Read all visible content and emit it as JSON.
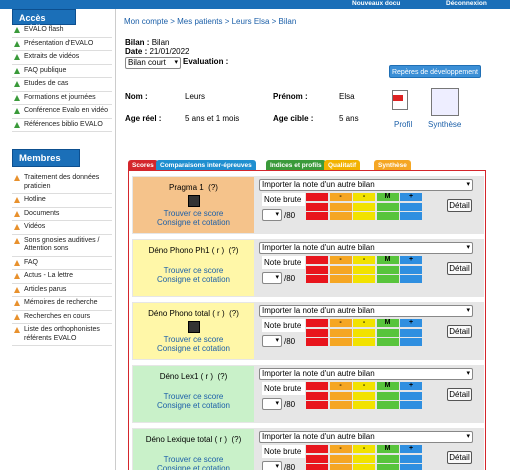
{
  "topbar": {
    "news": "Nouveaux docu",
    "logout": "Déconnexion"
  },
  "sidebar": {
    "public_title": "Accès public",
    "public_items": [
      "EVALO flash",
      "Présentation d'EVALO",
      "Extraits de vidéos",
      "FAQ publique",
      "Etudes de cas",
      "Formations et journées",
      "Conférence Evalo en vidéo",
      "Références biblio EVALO"
    ],
    "members_title": "Membres",
    "members_items": [
      "Traitement des données praticien",
      "Hotline",
      "Documents",
      "Vidéos",
      "Sons gnosies auditives / Attention sons",
      "FAQ",
      "Actus - La lettre",
      "Articles parus",
      "Mémoires de recherche",
      "Recherches en cours",
      "Liste des orthophonistes référents EVALO"
    ]
  },
  "breadcrumb": "Mon compte > Mes patients > Leurs Elsa > Bilan",
  "bilan": {
    "bilan_label": "Bilan :",
    "bilan_value": "Bilan",
    "date_label": "Date :",
    "date_value": "21/01/2022",
    "select_value": "Bilan court",
    "evaluation_label": "Evaluation :",
    "repere_button": "Repères de développement"
  },
  "patient": {
    "nom_label": "Nom :",
    "nom_value": "Leurs",
    "prenom_label": "Prénom :",
    "prenom_value": "Elsa",
    "age_reel_label": "Age réel :",
    "age_reel_value": "5 ans et 1 mois",
    "age_cible_label": "Age cible :",
    "age_cible_value": "5 ans",
    "profil_label": "Profil",
    "synthese_label": "Synthèse"
  },
  "tabs": [
    {
      "label": "Scores",
      "color": "#d4262c"
    },
    {
      "label": "Comparaisons inter-épreuves",
      "color": "#1f8fd0"
    },
    {
      "label": "Indices et profils",
      "color": "#3a9a3a"
    },
    {
      "label": "Qualitatif",
      "color": "#f2b200"
    },
    {
      "label": "Synthèse",
      "color": "#f5a623"
    }
  ],
  "tests": [
    {
      "name": "Pragma 1",
      "help": "(?)",
      "link1": "Trouver ce score",
      "link2": "Consigne et cotation",
      "bg": "#f5c38b",
      "video": true
    },
    {
      "name": "Déno Phono Ph1 ( r )",
      "help": "(?)",
      "link1": "Trouver ce score",
      "link2": "Consigne et cotation",
      "bg": "#fff7a8",
      "video": false
    },
    {
      "name": "Déno Phono total ( r )",
      "help": "(?)",
      "link1": "Trouver ce score",
      "link2": "Consigne et cotation",
      "bg": "#fff7a8",
      "video": true
    },
    {
      "name": "Déno Lex1 ( r )",
      "help": "(?)",
      "link1": "Trouver ce score",
      "link2": "Consigne et cotation",
      "bg": "#c9f1c9",
      "video": false
    },
    {
      "name": "Déno Lexique total ( r )",
      "help": "(?)",
      "link1": "Trouver ce score",
      "link2": "Consigne et cotation",
      "bg": "#c9f1c9",
      "video": false
    }
  ],
  "row_controls": {
    "import_select": "Importer la note d'un autre bilan",
    "note_brute": "Note brute",
    "slash80": "/80",
    "detail": "Détail",
    "grid_labels": [
      "-",
      "-",
      "M",
      "+"
    ],
    "grid_colors": [
      "#e8141c",
      "#f5a623",
      "#f2e200",
      "#58c43c",
      "#2f8fe0"
    ]
  }
}
